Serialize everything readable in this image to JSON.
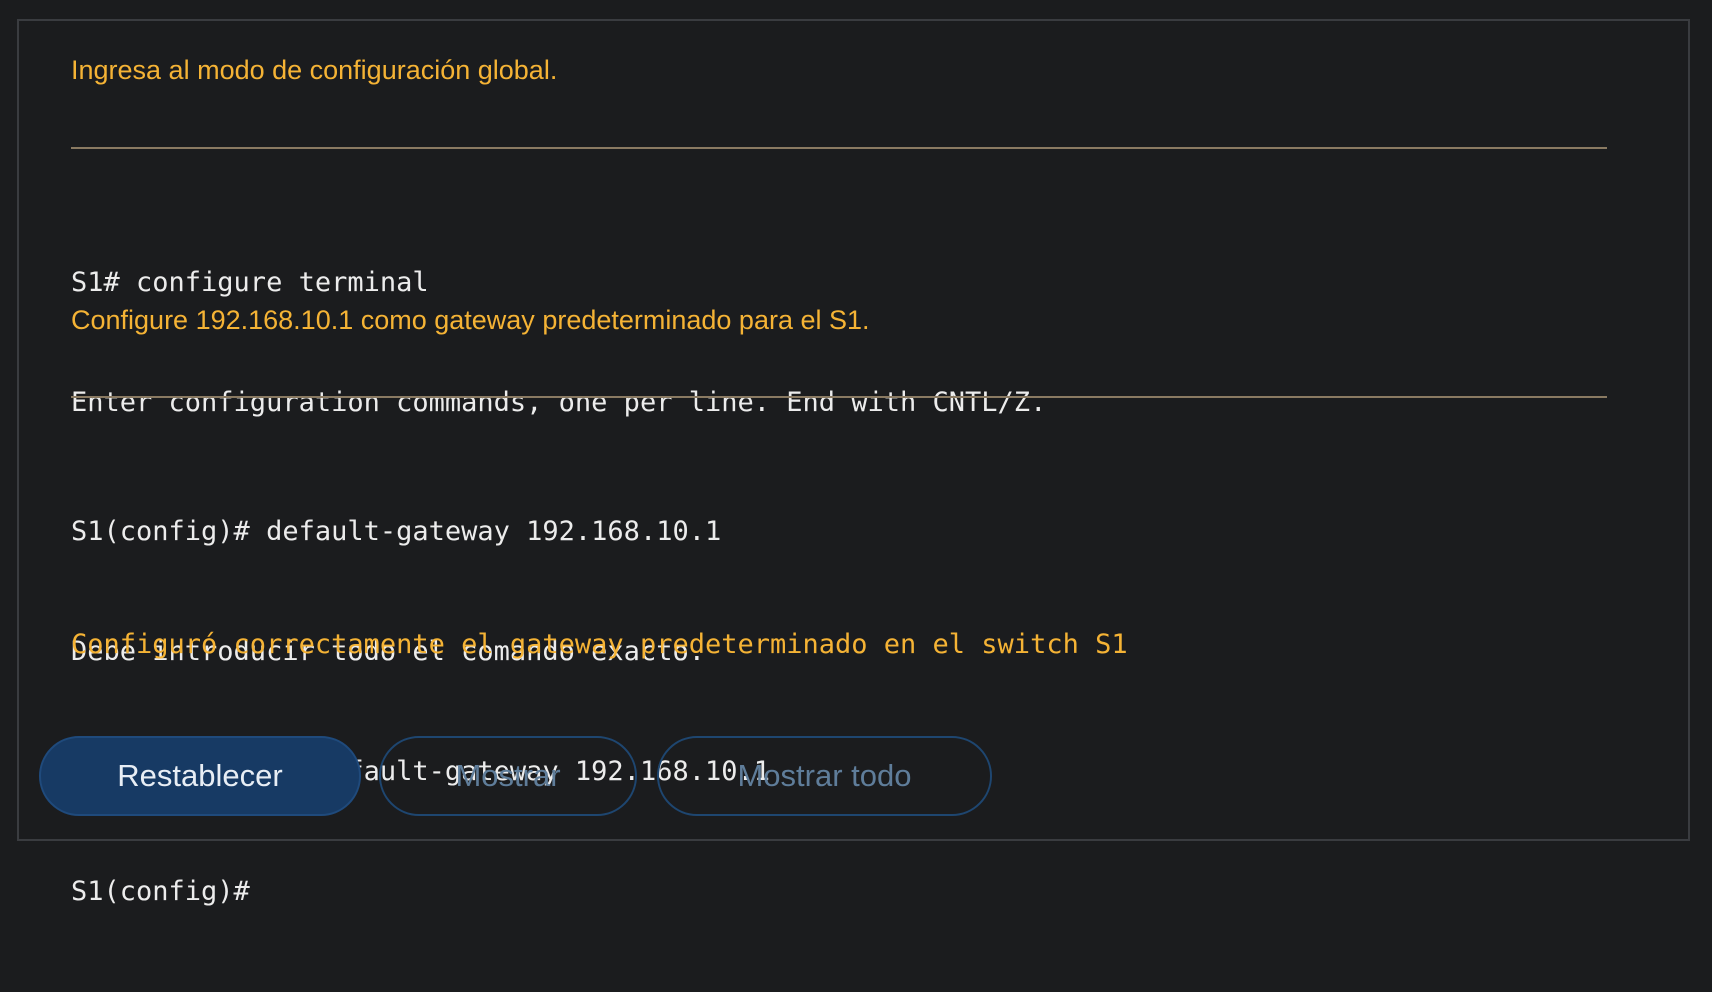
{
  "steps": [
    {
      "instruction": "Ingresa al modo de configuración global.",
      "terminal_lines": [
        "S1# configure terminal",
        "Enter configuration commands, one per line. End with CNTL/Z."
      ]
    },
    {
      "instruction": "Configure 192.168.10.1 como gateway predeterminado para el S1.",
      "terminal_lines": [
        "S1(config)# default-gateway 192.168.10.1",
        "Debe introducir todo el comando exacto.",
        "S1(config)# ip default-gateway 192.168.10.1",
        "S1(config)#"
      ]
    }
  ],
  "success_message": "Configuró correctamente el gateway predeterminado en el switch S1",
  "buttons": {
    "reset_label": "Restablecer",
    "show_label": "Mostrar",
    "show_all_label": "Mostrar todo"
  },
  "colors": {
    "background": "#1b1c1e",
    "instruction_text": "#f5b335",
    "terminal_text": "#ececec",
    "primary_button": "#173a64",
    "secondary_button_border": "#1e4670"
  }
}
